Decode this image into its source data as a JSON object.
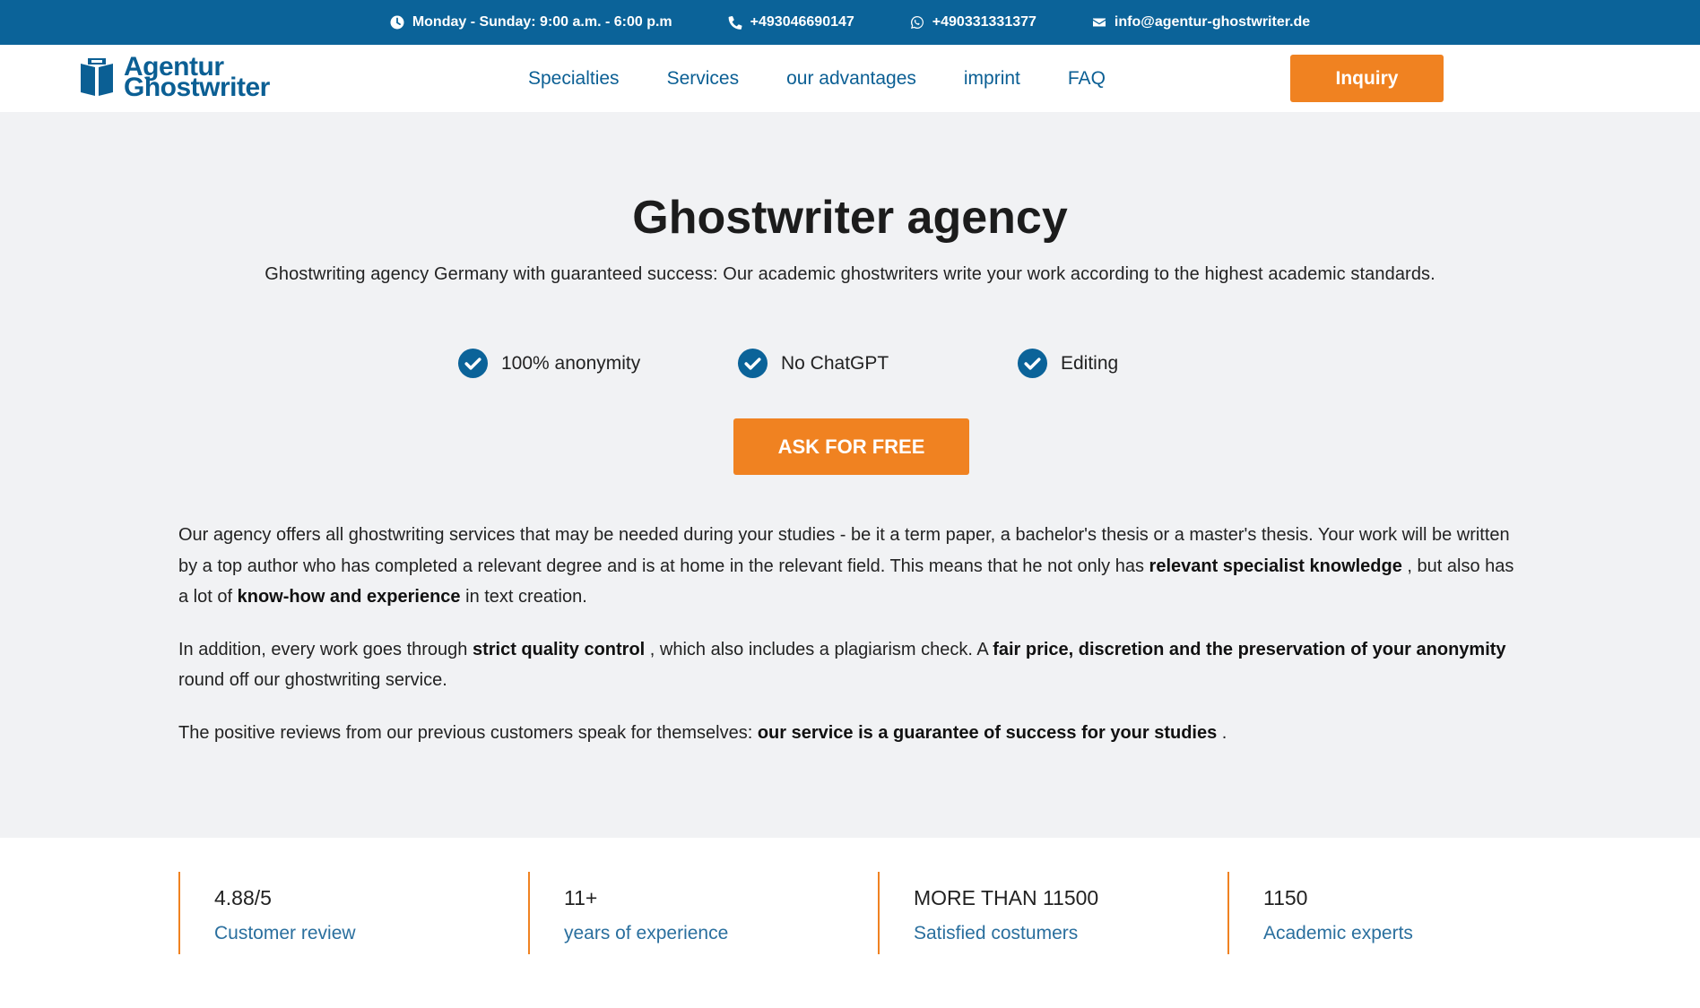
{
  "topbar": {
    "hours": "Monday - Sunday: 9:00 a.m. - 6:00 p.m",
    "phone": "+493046690147",
    "whatsapp": "+490331331377",
    "email": "info@agentur-ghostwriter.de"
  },
  "logo": {
    "line1": "Agentur",
    "line2": "Ghostwriter"
  },
  "nav": {
    "items": [
      {
        "label": "Specialties"
      },
      {
        "label": "Services"
      },
      {
        "label": "our advantages"
      },
      {
        "label": "imprint"
      },
      {
        "label": "FAQ"
      }
    ],
    "inquiry_label": "Inquiry"
  },
  "hero": {
    "title": "Ghostwriter agency",
    "subtitle": "Ghostwriting agency Germany with guaranteed success: Our academic ghostwriters write your work according to the highest academic standards.",
    "checks": [
      {
        "label": "100% anonymity"
      },
      {
        "label": "No ChatGPT"
      },
      {
        "label": "Editing"
      }
    ],
    "cta_label": "ASK FOR FREE",
    "p1": {
      "a": "Our agency offers all ghostwriting services that may be needed during your studies - be it a term paper, a bachelor's thesis or a master's thesis. Your work will be written by a top author who has completed a relevant degree and is at home in the relevant field. This means that he not only has ",
      "b1": "relevant specialist knowledge",
      "c": " , but also has a lot of ",
      "b2": "know-how and experience",
      "d": " in text creation."
    },
    "p2": {
      "a": "In addition, every work goes through ",
      "b1": "strict quality control",
      "c": " , which also includes a plagiarism check. A ",
      "b2": "fair price, discretion and the preservation of your anonymity",
      "d": " round off our ghostwriting service."
    },
    "p3": {
      "a": "The positive reviews from our previous customers speak for themselves: ",
      "b1": "our service is a guarantee of success for your studies",
      "c": " ."
    }
  },
  "stats": [
    {
      "value": "4.88/5",
      "label": "Customer review"
    },
    {
      "value": "11+",
      "label": "years of experience"
    },
    {
      "value": "MORE THAN 11500",
      "label": "Satisfied costumers"
    },
    {
      "value": "1150",
      "label": "Academic experts"
    }
  ],
  "colors": {
    "brand_blue": "#0b6399",
    "accent_orange": "#f08221",
    "hero_bg": "#f1f2f4"
  }
}
